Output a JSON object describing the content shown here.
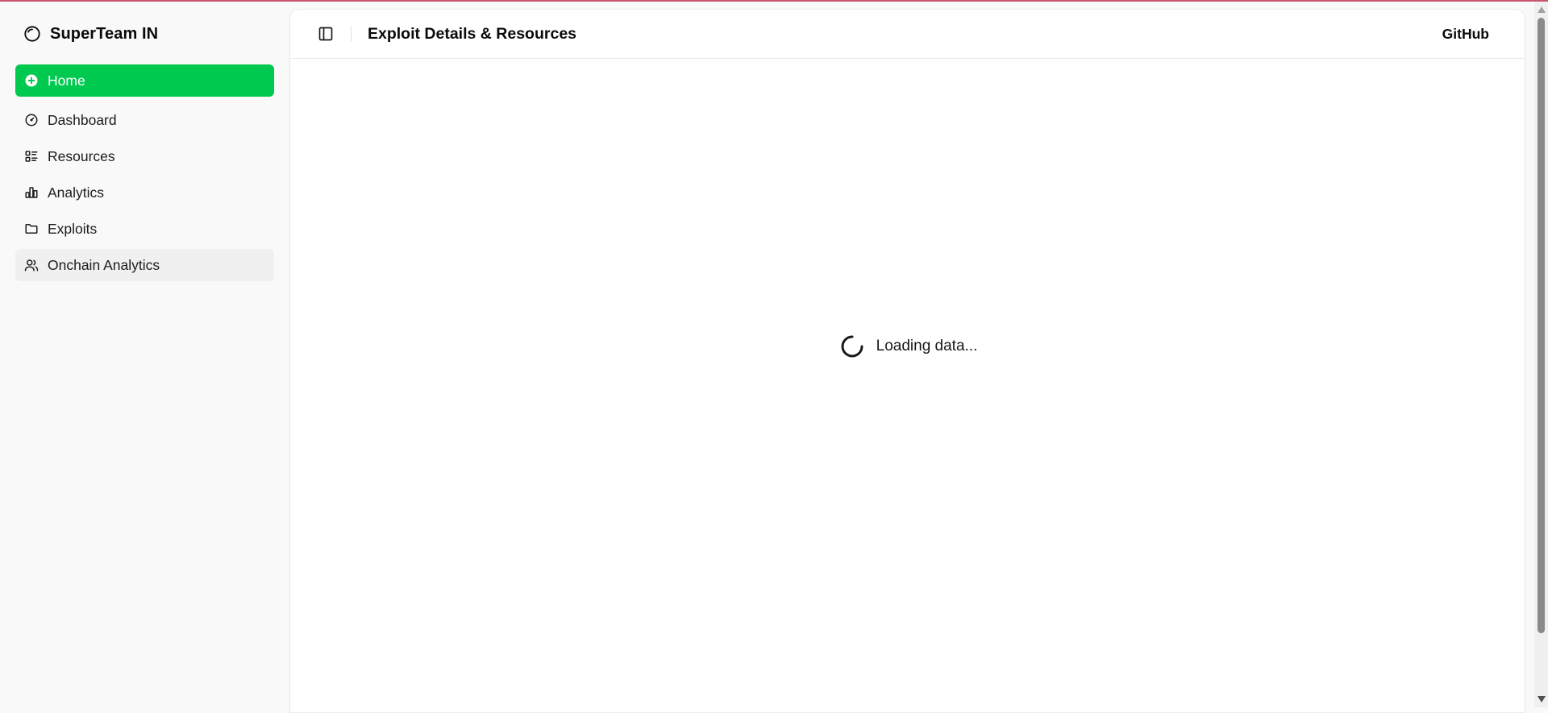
{
  "app": {
    "brand_name": "SuperTeam IN",
    "accent_color": "#00c950"
  },
  "sidebar": {
    "items": [
      {
        "label": "Home",
        "icon": "plus-circle-icon",
        "state": "active"
      },
      {
        "label": "Dashboard",
        "icon": "gauge-icon",
        "state": "default"
      },
      {
        "label": "Resources",
        "icon": "list-icon",
        "state": "default"
      },
      {
        "label": "Analytics",
        "icon": "bar-chart-icon",
        "state": "default"
      },
      {
        "label": "Exploits",
        "icon": "folder-icon",
        "state": "default"
      },
      {
        "label": "Onchain Analytics",
        "icon": "users-icon",
        "state": "hovered"
      }
    ]
  },
  "header": {
    "title": "Exploit Details & Resources",
    "github_label": "GitHub",
    "toggle_icon": "sidebar-toggle-icon"
  },
  "main": {
    "loading_text": "Loading data..."
  }
}
